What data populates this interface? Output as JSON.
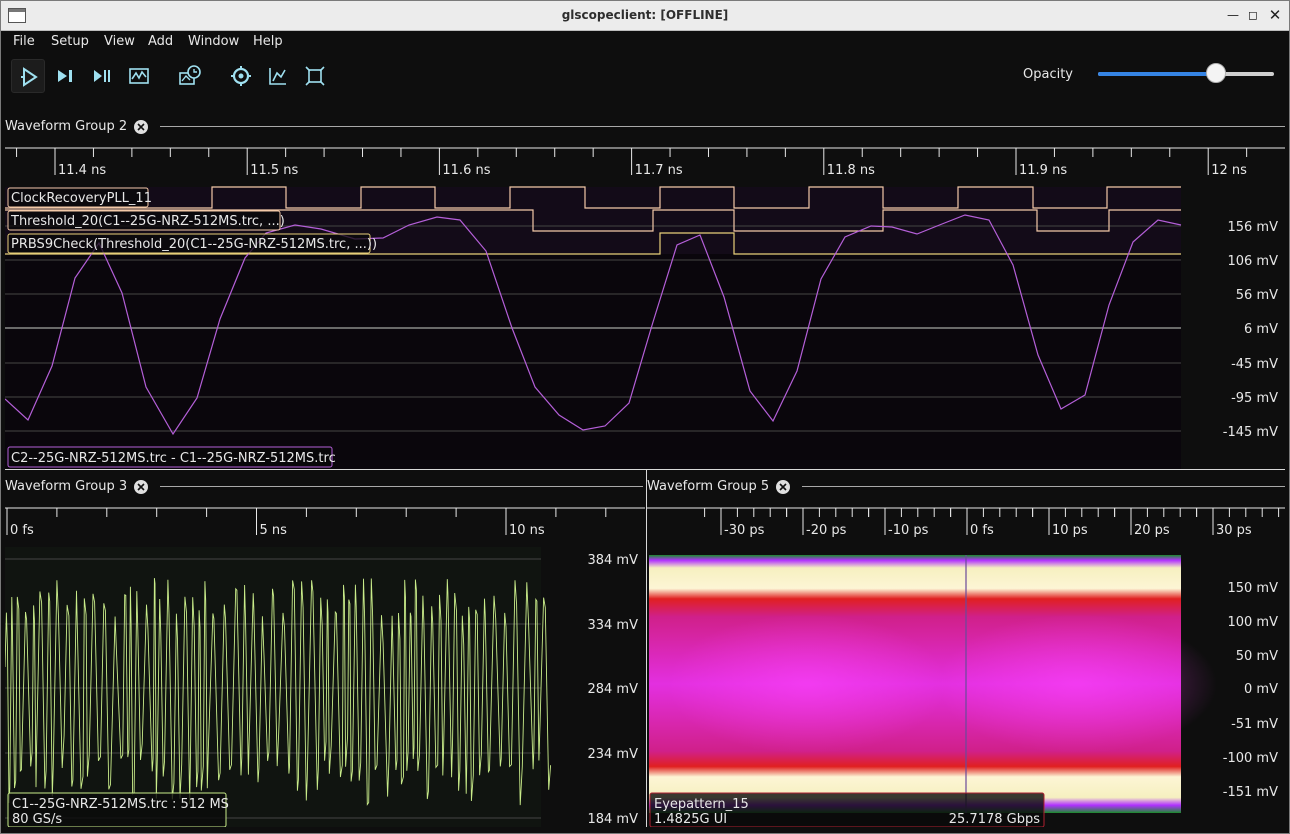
{
  "window": {
    "title": "glscopeclient: [OFFLINE]"
  },
  "menu": [
    "File",
    "Setup",
    "View",
    "Add",
    "Window",
    "Help"
  ],
  "toolbar": {
    "buttons": [
      {
        "name": "start-trigger-button",
        "icon": "play-icon"
      },
      {
        "name": "single-trigger-button",
        "icon": "step-icon"
      },
      {
        "name": "force-trigger-button",
        "icon": "force-icon"
      },
      {
        "name": "stop-trigger-button",
        "icon": "waveform-icon"
      },
      {
        "name": "history-button",
        "icon": "history-icon"
      },
      {
        "name": "refresh-button",
        "icon": "refresh-icon"
      },
      {
        "name": "fullscreen-button",
        "icon": "fullscreen-icon"
      },
      {
        "name": "zoom-fit-button",
        "icon": "zoom-fit-icon"
      }
    ],
    "opacity_label": "Opacity",
    "opacity_value": 0.67
  },
  "groups": {
    "g2": {
      "title": "Waveform Group 2",
      "timeline": [
        "11.4 ns",
        "11.5 ns",
        "11.6 ns",
        "11.7 ns",
        "11.8 ns",
        "11.9 ns",
        "12 ns"
      ],
      "yaxis": [
        "156 mV",
        "106 mV",
        "56 mV",
        "6 mV",
        "-45 mV",
        "-95 mV",
        "-145 mV"
      ],
      "digital_traces": [
        {
          "label": "ClockRecoveryPLL_11",
          "color": "#f3c9a8"
        },
        {
          "label": "Threshold_20(C1--25G-NRZ-512MS.trc, ...)",
          "color": "#f3c9a8"
        },
        {
          "label": "PRBS9Check(Threshold_20(C1--25G-NRZ-512MS.trc, ...))",
          "color": "#e8d07a"
        }
      ],
      "analog_trace": {
        "label": "C2--25G-NRZ-512MS.trc - C1--25G-NRZ-512MS.trc",
        "color": "#b45fd8"
      }
    },
    "g3": {
      "title": "Waveform Group 3",
      "timeline": [
        "0 fs",
        "5 ns",
        "10 ns"
      ],
      "yaxis": [
        "384 mV",
        "334 mV",
        "284 mV",
        "234 mV",
        "184 mV"
      ],
      "trace": {
        "label": "C1--25G-NRZ-512MS.trc : 512 MS",
        "sub": "80 GS/s",
        "color": "#c9ec8a"
      }
    },
    "g5": {
      "title": "Waveform Group 5",
      "timeline": [
        "-30 ps",
        "-20 ps",
        "-10 ps",
        "0 fs",
        "10 ps",
        "20 ps",
        "30 ps"
      ],
      "yaxis": [
        "150 mV",
        "100 mV",
        "50 mV",
        "0 mV",
        "-51 mV",
        "-100 mV",
        "-151 mV"
      ],
      "trace": {
        "label": "Eyepattern_15",
        "ui": "1.4825G UI",
        "rate": "25.7178 Gbps",
        "color": "#b02030"
      }
    }
  }
}
